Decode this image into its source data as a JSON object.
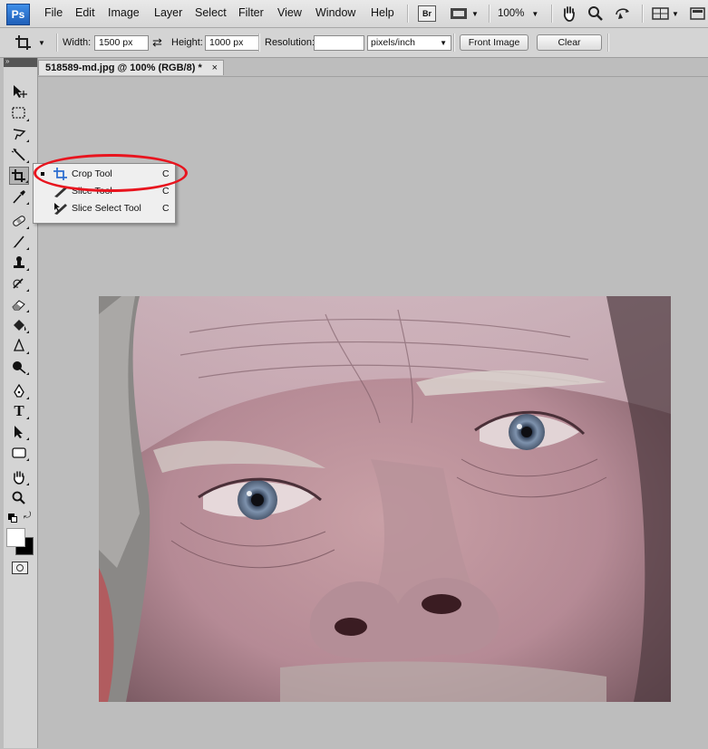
{
  "app": {
    "logo": "Ps"
  },
  "menu": [
    "File",
    "Edit",
    "Image",
    "Layer",
    "Select",
    "Filter",
    "View",
    "Window",
    "Help"
  ],
  "menubar": {
    "bridge_label": "Br",
    "zoom": "100%"
  },
  "options": {
    "width_label": "Width:",
    "width_value": "1500 px",
    "height_label": "Height:",
    "height_value": "1000 px",
    "resolution_label": "Resolution:",
    "resolution_value": "",
    "units": "pixels/inch",
    "front_image": "Front Image",
    "clear": "Clear"
  },
  "document": {
    "tab_title": "518589-md.jpg @ 100% (RGB/8) *",
    "close": "×"
  },
  "flyout": {
    "items": [
      {
        "label": "Crop Tool",
        "shortcut": "C",
        "icon": "crop-icon",
        "selected": true
      },
      {
        "label": "Slice Tool",
        "shortcut": "C",
        "icon": "slice-icon",
        "selected": false
      },
      {
        "label": "Slice Select Tool",
        "shortcut": "C",
        "icon": "slice-select-icon",
        "selected": false
      }
    ]
  },
  "colors": {
    "annotation": "#e8141e",
    "accent": "#2f6fd0"
  }
}
